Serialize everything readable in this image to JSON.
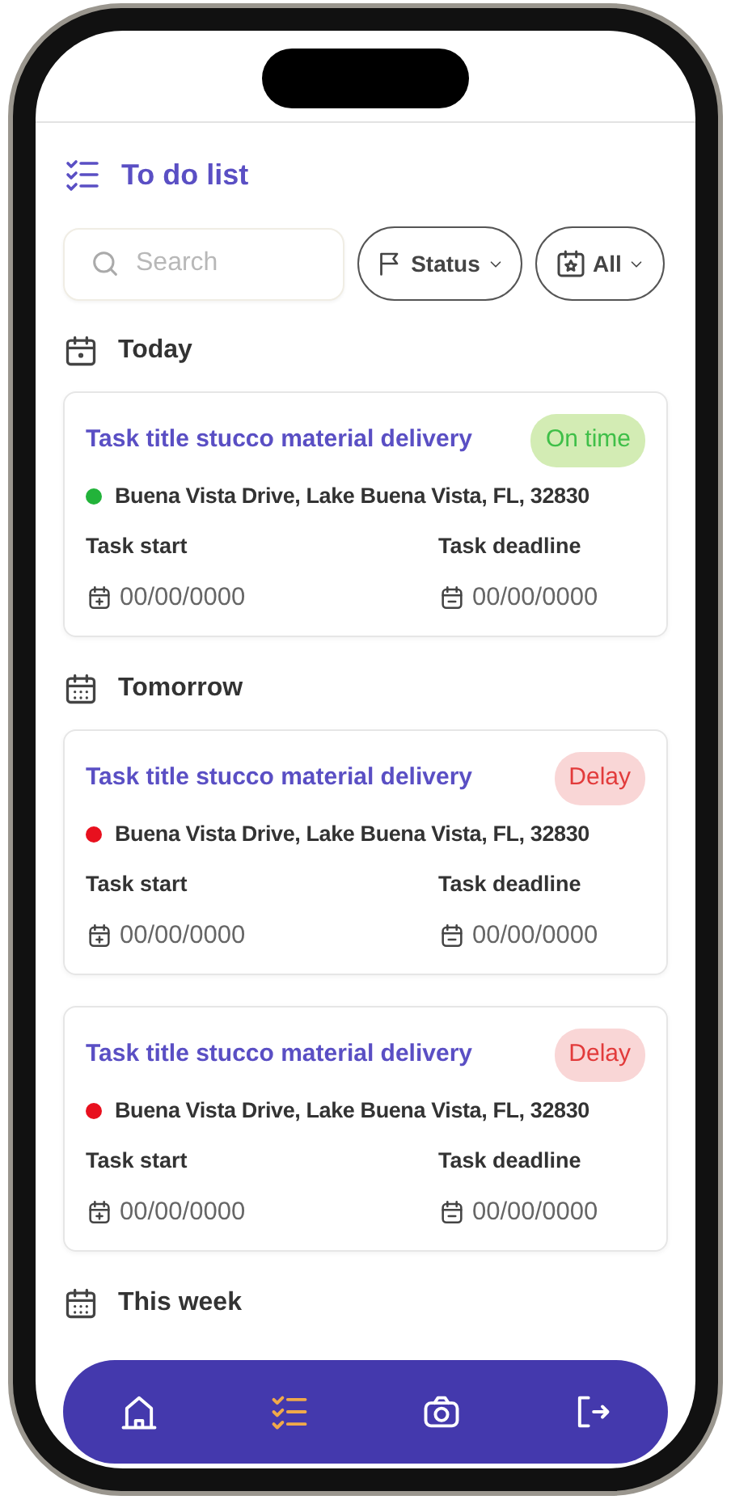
{
  "header": {
    "title": "To do list"
  },
  "search": {
    "placeholder": "Search"
  },
  "filters": [
    {
      "label": "Status",
      "kind": "flag"
    },
    {
      "label": "All",
      "kind": "calendar"
    }
  ],
  "groups": [
    {
      "title": "Today",
      "kind": "day",
      "tasks": [
        {
          "title": "Task title stucco material delivery",
          "status": "On time",
          "kind": "ontime",
          "color": "#22b33a",
          "address": "Buena Vista Drive, Lake Buena Vista, FL, 32830",
          "start_label": "Task start",
          "start": "00/00/0000",
          "deadline_label": "Task deadline",
          "deadline": "00/00/0000"
        }
      ]
    },
    {
      "title": "Tomorrow",
      "kind": "week",
      "tasks": [
        {
          "title": "Task title stucco material delivery",
          "status": "Delay",
          "kind": "delay",
          "color": "#e8101e",
          "address": "Buena Vista Drive, Lake Buena Vista, FL, 32830",
          "start_label": "Task start",
          "start": "00/00/0000",
          "deadline_label": "Task deadline",
          "deadline": "00/00/0000"
        },
        {
          "title": "Task title stucco material delivery",
          "status": "Delay",
          "kind": "delay",
          "color": "#e8101e",
          "address": "Buena Vista Drive, Lake Buena Vista, FL, 32830",
          "start_label": "Task start",
          "start": "00/00/0000",
          "deadline_label": "Task deadline",
          "deadline": "00/00/0000"
        }
      ]
    },
    {
      "title": "This week",
      "kind": "week"
    }
  ],
  "nav": [
    {
      "kind": "home",
      "selected": false
    },
    {
      "kind": "list",
      "selected": true
    },
    {
      "kind": "camera",
      "selected": false
    },
    {
      "kind": "logout",
      "selected": false
    }
  ]
}
